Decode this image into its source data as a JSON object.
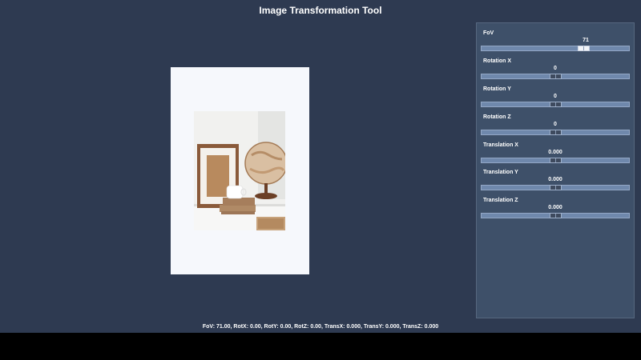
{
  "app": {
    "title": "Image Transformation Tool"
  },
  "controls": [
    {
      "label": "FoV",
      "value": "71",
      "position": 0.71
    },
    {
      "label": "Rotation X",
      "value": "0",
      "position": 0.5
    },
    {
      "label": "Rotation Y",
      "value": "0",
      "position": 0.5
    },
    {
      "label": "Rotation Z",
      "value": "0",
      "position": 0.5
    },
    {
      "label": "Translation X",
      "value": "0.000",
      "position": 0.5
    },
    {
      "label": "Translation Y",
      "value": "0.000",
      "position": 0.5
    },
    {
      "label": "Translation Z",
      "value": "0.000",
      "position": 0.5
    }
  ],
  "status": {
    "text": "FoV: 71.00, RotX: 0.00, RotY: 0.00, RotZ: 0.00, TransX: 0.000, TransY: 0.000, TransZ: 0.000"
  },
  "colors": {
    "background": "#2e3a51",
    "panel": "#3e5069",
    "track": "#6f88ac",
    "canvas": "#f6f8fc"
  }
}
